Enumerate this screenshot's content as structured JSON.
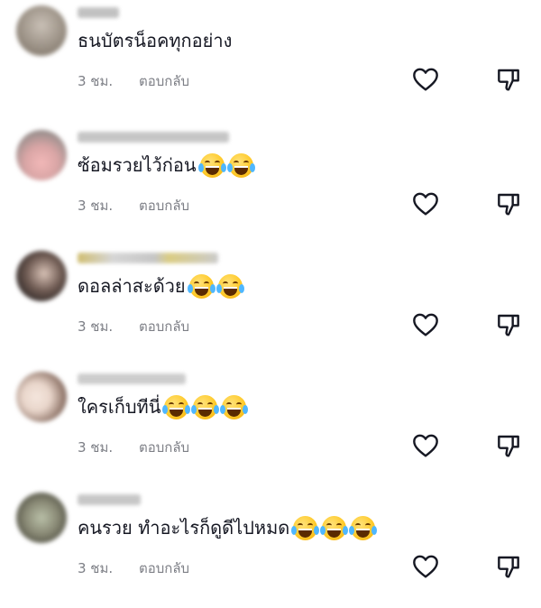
{
  "comments": [
    {
      "text": "ธนบัตรน็อคทุกอย่าง",
      "emoji_count": 0,
      "time": "3 ชม.",
      "reply_label": "ตอบกลับ",
      "avatar_colors": [
        "#c9c0b6",
        "#8f8579"
      ]
    },
    {
      "text": "ซ้อมรวยไว้ก่อน",
      "emoji_count": 2,
      "time": "3 ชม.",
      "reply_label": "ตอบกลับ",
      "avatar_colors": [
        "#f2b8b8",
        "#9a8f8d"
      ]
    },
    {
      "text": "ดอลล่าสะด้วย",
      "emoji_count": 2,
      "time": "3 ชม.",
      "reply_label": "ตอบกลับ",
      "avatar_colors": [
        "#6e5a52",
        "#2d2726"
      ]
    },
    {
      "text": "ใครเก็บทีนี่",
      "emoji_count": 3,
      "time": "3 ชม.",
      "reply_label": "ตอบกลับ",
      "avatar_colors": [
        "#e9d6cb",
        "#7a5e52"
      ]
    },
    {
      "text": "คนรวย ทำอะไรก็ดูดีไปหมด ",
      "emoji_count": 3,
      "time": "3 ชม.",
      "reply_label": "ตอบกลับ",
      "avatar_colors": [
        "#b9c0a8",
        "#4a4a3e"
      ]
    }
  ],
  "icons": {
    "like": "heart-outline-icon",
    "dislike": "thumbs-down-outline-icon",
    "emoji": "face-with-tears-of-joy"
  },
  "colors": {
    "text": "#161823",
    "meta": "#7d7f86",
    "icon_stroke": "#161823"
  }
}
